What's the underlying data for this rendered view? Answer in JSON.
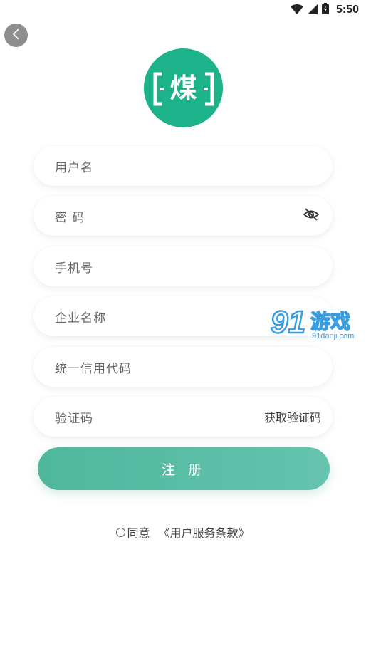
{
  "status_bar": {
    "time": "5:50",
    "icons": [
      "wifi-icon",
      "signal-icon",
      "battery-icon"
    ]
  },
  "header": {
    "back_icon": "chevron-left-icon"
  },
  "logo": {
    "character": "煤",
    "color": "#1db38a"
  },
  "form": {
    "username_placeholder": "用户名",
    "password_placeholder": "密 码",
    "password_toggle_icon": "eye-off-icon",
    "phone_placeholder": "手机号",
    "company_placeholder": "企业名称",
    "credit_code_placeholder": "统一信用代码",
    "code_placeholder": "验证码",
    "get_code_label": "获取验证码"
  },
  "submit": {
    "label": "注 册",
    "color_start": "#4fb79c",
    "color_end": "#65c3ae"
  },
  "agreement": {
    "prefix": "同意",
    "link": "《用户服务条款》"
  },
  "watermark": {
    "number": "91",
    "brand": "游戏",
    "url": "91danji.com"
  }
}
